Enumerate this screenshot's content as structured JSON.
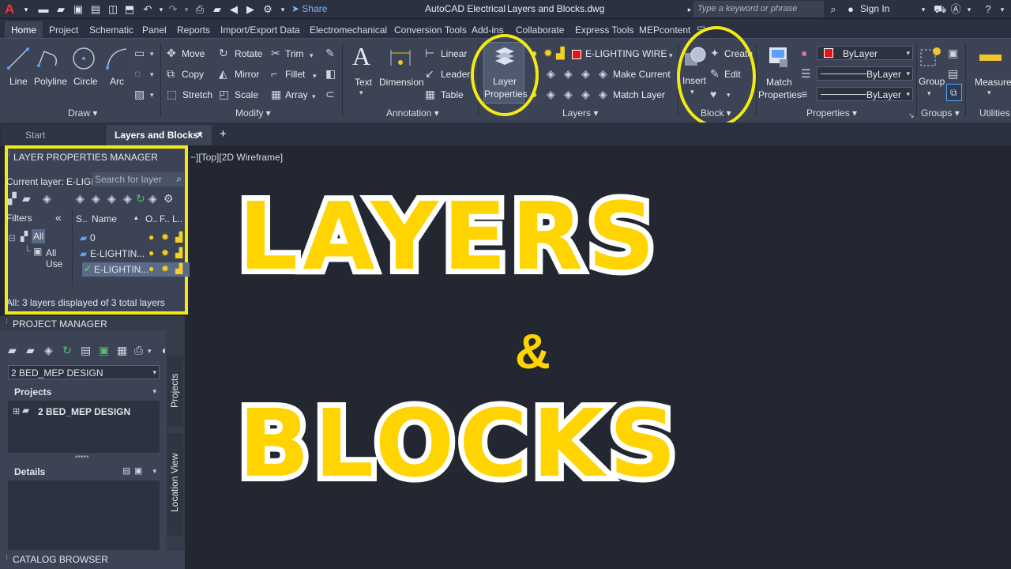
{
  "titlebar": {
    "app_logo": "A",
    "share_label": "Share",
    "app_name": "AutoCAD Electrical",
    "file_name": "Layers and Blocks.dwg",
    "search_placeholder": "Type a keyword or phrase",
    "signin_label": "Sign In"
  },
  "ribbon_tabs": [
    "Home",
    "Project",
    "Schematic",
    "Panel",
    "Reports",
    "Import/Export Data",
    "Electromechanical",
    "Conversion Tools",
    "Add-ins",
    "Collaborate",
    "Express Tools",
    "MEPcontent"
  ],
  "ribbon": {
    "draw": {
      "line": "Line",
      "polyline": "Polyline",
      "circle": "Circle",
      "arc": "Arc",
      "footer": "Draw"
    },
    "modify": {
      "move": "Move",
      "rotate": "Rotate",
      "trim": "Trim",
      "copy": "Copy",
      "mirror": "Mirror",
      "fillet": "Fillet",
      "stretch": "Stretch",
      "scale": "Scale",
      "array": "Array",
      "footer": "Modify"
    },
    "annotation": {
      "text": "Text",
      "dimension": "Dimension",
      "linear": "Linear",
      "leader": "Leader",
      "table": "Table",
      "footer": "Annotation"
    },
    "layers": {
      "layer_properties_line1": "Layer",
      "layer_properties_line2": "Properties",
      "current_layer": "E-LIGHTING WIRE",
      "make_current": "Make Current",
      "match_layer": "Match Layer",
      "footer": "Layers"
    },
    "block": {
      "insert": "Insert",
      "create": "Create",
      "edit": "Edit",
      "footer": "Block"
    },
    "properties": {
      "match_line1": "Match",
      "match_line2": "Properties",
      "color": "ByLayer",
      "linetype": "ByLayer",
      "lineweight": "ByLayer",
      "footer": "Properties"
    },
    "groups": {
      "group": "Group",
      "footer": "Groups"
    },
    "utilities": {
      "measure": "Measure",
      "footer": "Utilities"
    },
    "colors": {
      "accent_red": "#e01616",
      "highlight": "#f3ea14"
    }
  },
  "doc_tabs": {
    "start": "Start",
    "active": "Layers and Blocks*",
    "add": "+"
  },
  "viewport_label": "−][Top][2D Wireframe]",
  "layer_manager": {
    "title": "LAYER PROPERTIES MANAGER",
    "current_layer_label": "Current layer: E-LIGHT",
    "search_placeholder": "Search for layer",
    "filters_label": "Filters",
    "filter_all": "All",
    "filter_all_used": "All Use",
    "col_status": "S..",
    "col_name": "Name",
    "col_on": "O..",
    "col_freeze": "F..",
    "col_lock": "L..",
    "layers": [
      "0",
      "E-LIGHTIN...",
      "E-LIGHTIN..."
    ],
    "status_text": "All: 3 layers displayed of 3 total layers"
  },
  "project_manager": {
    "title": "PROJECT MANAGER",
    "project_select": "2 BED_MEP DESIGN",
    "projects_header": "Projects",
    "project_item": "2 BED_MEP DESIGN",
    "details_header": "Details",
    "side_tab_projects": "Projects",
    "side_tab_location": "Location View"
  },
  "catalog_browser": "CATALOG BROWSER",
  "overlay": {
    "line1": "LAYERS",
    "amp": "&",
    "line2": "BLOCKS"
  }
}
